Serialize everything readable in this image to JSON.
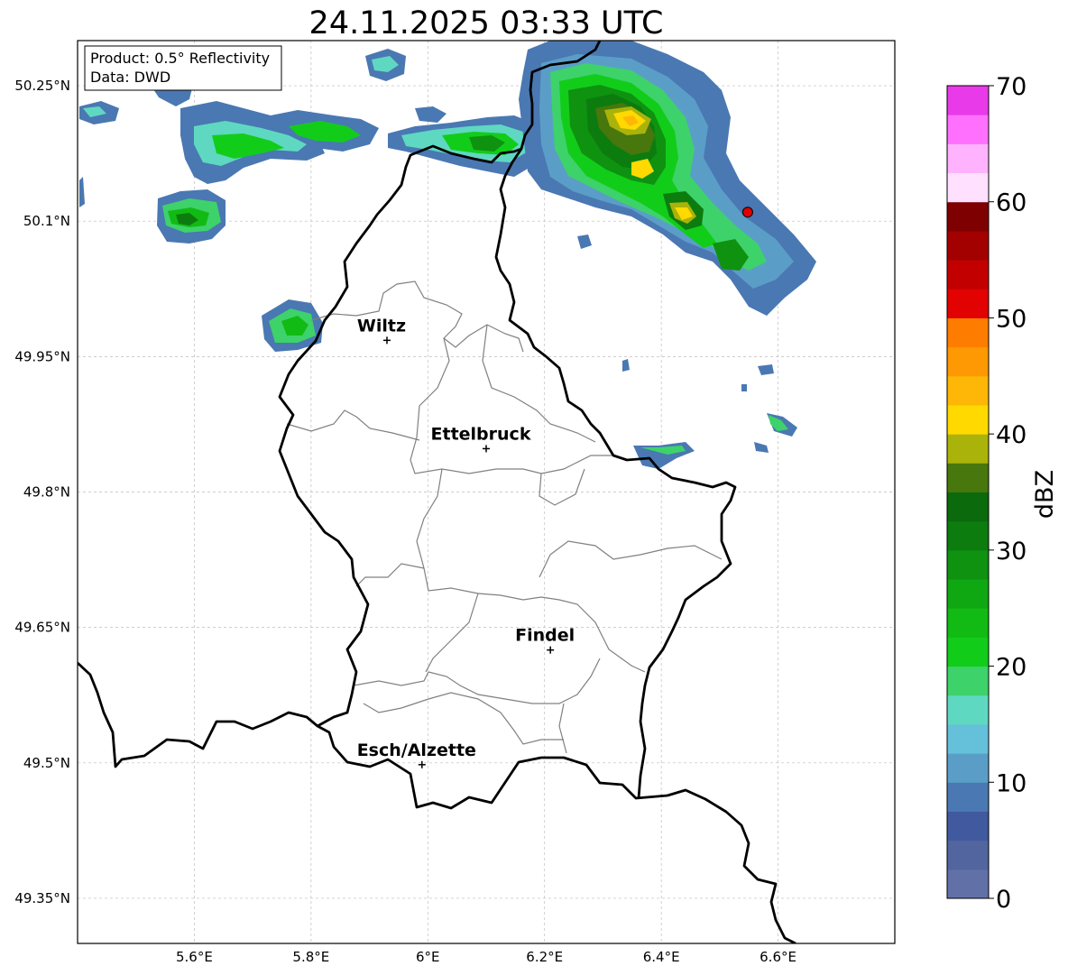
{
  "title": "24.11.2025 03:33 UTC",
  "info_box": {
    "product_line": "Product: 0.5° Reflectivity",
    "data_line": "Data: DWD"
  },
  "map": {
    "lon_range": [
      5.4,
      6.8
    ],
    "lat_range": [
      49.3,
      50.3
    ],
    "x_ticks": [
      {
        "value": 5.6,
        "label": "5.6°E"
      },
      {
        "value": 5.8,
        "label": "5.8°E"
      },
      {
        "value": 6.0,
        "label": "6°E"
      },
      {
        "value": 6.2,
        "label": "6.2°E"
      },
      {
        "value": 6.4,
        "label": "6.4°E"
      },
      {
        "value": 6.6,
        "label": "6.6°E"
      }
    ],
    "y_ticks": [
      {
        "value": 50.25,
        "label": "50.25°N"
      },
      {
        "value": 50.1,
        "label": "50.1°N"
      },
      {
        "value": 49.95,
        "label": "49.95°N"
      },
      {
        "value": 49.8,
        "label": "49.8°N"
      },
      {
        "value": 49.65,
        "label": "49.65°N"
      },
      {
        "value": 49.5,
        "label": "49.5°N"
      },
      {
        "value": 49.35,
        "label": "49.35°N"
      }
    ],
    "grid": true,
    "cities": [
      {
        "name": "Wiltz",
        "lon": 5.93,
        "lat": 49.968
      },
      {
        "name": "Ettelbruck",
        "lon": 6.1,
        "lat": 49.848
      },
      {
        "name": "Findel",
        "lon": 6.21,
        "lat": 49.625
      },
      {
        "name": "Esch/Alzette",
        "lon": 5.99,
        "lat": 49.498
      }
    ],
    "radar_site": {
      "lon": 6.548,
      "lat": 50.11,
      "color": "#e00000"
    }
  },
  "colorbar": {
    "label": "dBZ",
    "min": 0,
    "max": 70,
    "ticks": [
      "0",
      "10",
      "20",
      "30",
      "40",
      "50",
      "60",
      "70"
    ],
    "colors": [
      "#6270a8",
      "#52659e",
      "#41599e",
      "#4a78b2",
      "#5a9ec8",
      "#65c0da",
      "#5fd8c2",
      "#3ed26a",
      "#12cc1a",
      "#11bb14",
      "#10a812",
      "#0e9210",
      "#0c7c0e",
      "#0a6a0c",
      "#47770d",
      "#aab30a",
      "#ffd900",
      "#feb706",
      "#fe9903",
      "#fe7d00",
      "#e20202",
      "#c30000",
      "#a30000",
      "#7e0000",
      "#ffe0ff",
      "#ffb3ff",
      "#ff70ff",
      "#e93ae9"
    ]
  }
}
